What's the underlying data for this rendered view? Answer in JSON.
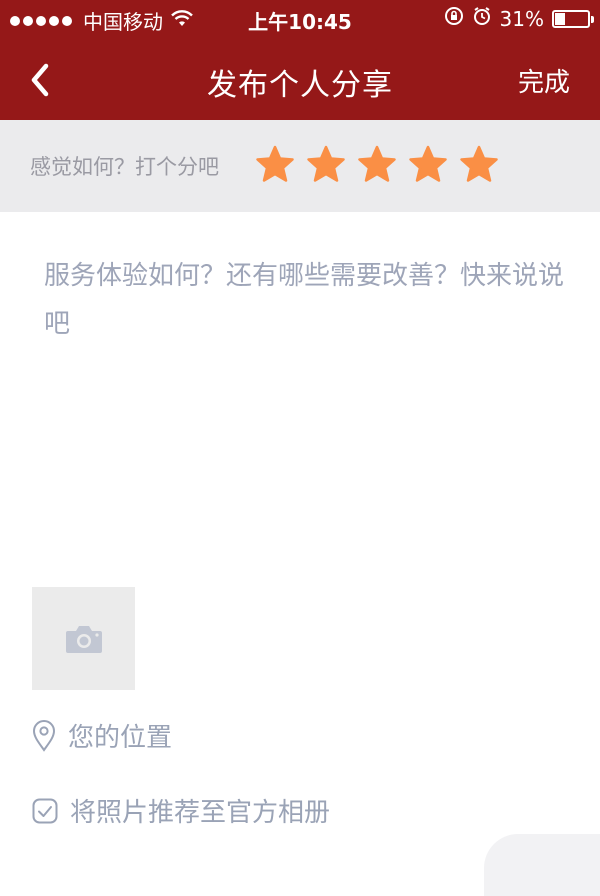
{
  "status_bar": {
    "carrier": "中国移动",
    "time": "上午10:45",
    "battery_percent": "31%",
    "battery_level": 0.31,
    "icons": [
      "signal-dots-icon",
      "wifi-icon",
      "orientation-lock-icon",
      "alarm-icon",
      "battery-icon"
    ]
  },
  "nav": {
    "back_icon": "chevron-left-icon",
    "title": "发布个人分享",
    "done_label": "完成"
  },
  "rating": {
    "prompt": "感觉如何？打个分吧",
    "stars_filled": 5,
    "stars_total": 5,
    "star_color": "#fa8f45"
  },
  "review": {
    "placeholder": "服务体验如何？还有哪些需要改善？快来说说吧"
  },
  "photo": {
    "icon": "camera-icon"
  },
  "location": {
    "icon": "location-pin-icon",
    "label": "您的位置"
  },
  "recommend": {
    "icon": "checkbox-icon",
    "label": "将照片推荐至官方相册"
  },
  "colors": {
    "header_bg": "#951818",
    "rating_strip_bg": "#ebebed",
    "placeholder_text": "#9ea5b8"
  }
}
